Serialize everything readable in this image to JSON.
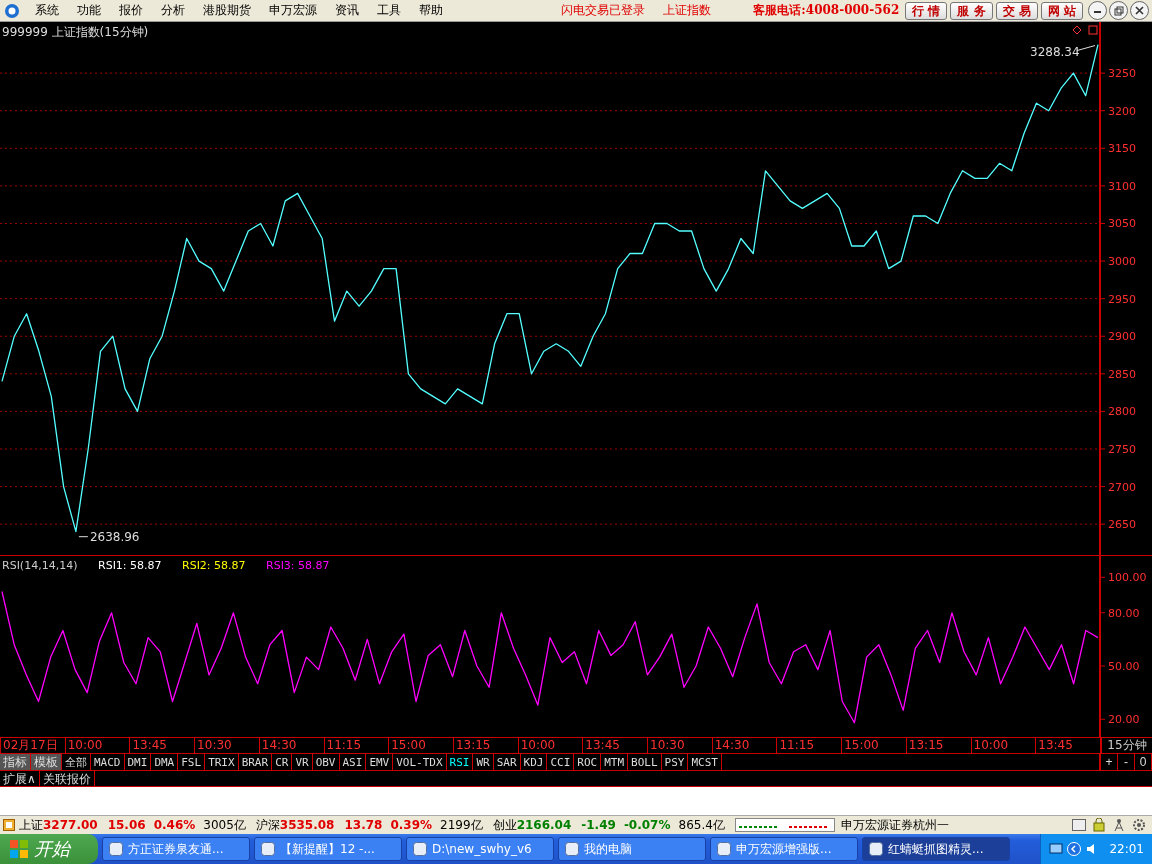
{
  "menu": {
    "items": [
      "系统",
      "功能",
      "报价",
      "分析",
      "港股期货",
      "申万宏源",
      "资讯",
      "工具",
      "帮助"
    ],
    "notices": [
      "闪电交易已登录",
      "上证指数"
    ],
    "hotline": "客服电话:4008-000-562",
    "buttons": [
      "行 情",
      "服 务",
      "交 易",
      "网 站"
    ]
  },
  "main_chart": {
    "title": "999999 上证指数(15分钟)",
    "chart_data": {
      "type": "line",
      "grid": true,
      "ylim": [
        2609,
        3318
      ],
      "yticks": [
        2650,
        2700,
        2750,
        2800,
        2850,
        2900,
        2950,
        3000,
        3050,
        3100,
        3150,
        3200,
        3250
      ],
      "series": [
        {
          "color": "#54ffff",
          "values": [
            2840,
            2900,
            2930,
            2880,
            2820,
            2700,
            2640,
            2750,
            2880,
            2900,
            2830,
            2800,
            2870,
            2900,
            2960,
            3030,
            3000,
            2990,
            2960,
            3000,
            3040,
            3050,
            3020,
            3080,
            3090,
            3060,
            3030,
            2920,
            2960,
            2940,
            2960,
            2990,
            2990,
            2850,
            2830,
            2820,
            2810,
            2830,
            2820,
            2810,
            2890,
            2930,
            2930,
            2850,
            2880,
            2890,
            2880,
            2860,
            2900,
            2930,
            2990,
            3010,
            3010,
            3050,
            3050,
            3040,
            3040,
            2990,
            2960,
            2990,
            3030,
            3010,
            3120,
            3100,
            3080,
            3070,
            3080,
            3090,
            3070,
            3020,
            3020,
            3040,
            2990,
            3000,
            3060,
            3060,
            3050,
            3090,
            3120,
            3110,
            3110,
            3130,
            3120,
            3170,
            3210,
            3200,
            3230,
            3250,
            3220,
            3288
          ]
        }
      ],
      "annotations": [
        {
          "text": "3288.34"
        },
        {
          "text": "2638.96"
        }
      ]
    }
  },
  "rsi_chart": {
    "name": "RSI(14,14,14)",
    "lines": [
      {
        "label": "RSI1: 58.87",
        "color": "#ffffff"
      },
      {
        "label": "RSI2: 58.87",
        "color": "#ffff00"
      },
      {
        "label": "RSI3: 58.87",
        "color": "#ff00ff"
      }
    ],
    "chart_data": {
      "type": "line",
      "ylim": [
        10,
        112
      ],
      "yticks": [
        {
          "value": 20,
          "label": "20.00"
        },
        {
          "value": 50,
          "label": "50.00"
        },
        {
          "value": 80,
          "label": "80.00"
        },
        {
          "value": 100,
          "label": "100.00"
        }
      ],
      "series": [
        {
          "color": "#ff00ff",
          "values": [
            92,
            62,
            45,
            30,
            55,
            70,
            48,
            35,
            64,
            80,
            52,
            40,
            66,
            58,
            30,
            52,
            74,
            45,
            60,
            80,
            55,
            40,
            62,
            70,
            35,
            55,
            48,
            72,
            60,
            42,
            65,
            40,
            58,
            68,
            30,
            56,
            62,
            44,
            70,
            50,
            38,
            80,
            60,
            45,
            28,
            66,
            52,
            58,
            40,
            70,
            56,
            62,
            75,
            45,
            55,
            68,
            38,
            50,
            72,
            60,
            44,
            66,
            85,
            52,
            40,
            58,
            62,
            48,
            70,
            30,
            18,
            55,
            62,
            45,
            25,
            60,
            70,
            52,
            80,
            58,
            45,
            66,
            40,
            55,
            72,
            60,
            48,
            62,
            40,
            70,
            66
          ]
        }
      ]
    }
  },
  "time_axis": {
    "labels": [
      "02月17日",
      "10:00",
      "13:45",
      "10:30",
      "14:30",
      "11:15",
      "15:00",
      "13:15",
      "10:00",
      "13:45",
      "10:30",
      "14:30",
      "11:15",
      "15:00",
      "13:15",
      "10:00",
      "13:45"
    ],
    "period": "15分钟"
  },
  "indicator_tabs": [
    {
      "label": "指标",
      "kind": "group",
      "selected": false
    },
    {
      "label": "模板",
      "kind": "group",
      "selected": false
    },
    {
      "label": "全部",
      "kind": "indicator",
      "selected": false
    },
    {
      "label": "MACD",
      "kind": "indicator",
      "selected": false
    },
    {
      "label": "DMI",
      "kind": "indicator",
      "selected": false
    },
    {
      "label": "DMA",
      "kind": "indicator",
      "selected": false
    },
    {
      "label": "FSL",
      "kind": "indicator",
      "selected": false
    },
    {
      "label": "TRIX",
      "kind": "indicator",
      "selected": false
    },
    {
      "label": "BRAR",
      "kind": "indicator",
      "selected": false
    },
    {
      "label": "CR",
      "kind": "indicator",
      "selected": false
    },
    {
      "label": "VR",
      "kind": "indicator",
      "selected": false
    },
    {
      "label": "OBV",
      "kind": "indicator",
      "selected": false
    },
    {
      "label": "ASI",
      "kind": "indicator",
      "selected": false
    },
    {
      "label": "EMV",
      "kind": "indicator",
      "selected": false
    },
    {
      "label": "VOL-TDX",
      "kind": "indicator",
      "selected": false
    },
    {
      "label": "RSI",
      "kind": "indicator",
      "selected": true
    },
    {
      "label": "WR",
      "kind": "indicator",
      "selected": false
    },
    {
      "label": "SAR",
      "kind": "indicator",
      "selected": false
    },
    {
      "label": "KDJ",
      "kind": "indicator",
      "selected": false
    },
    {
      "label": "CCI",
      "kind": "indicator",
      "selected": false
    },
    {
      "label": "ROC",
      "kind": "indicator",
      "selected": false
    },
    {
      "label": "MTM",
      "kind": "indicator",
      "selected": false
    },
    {
      "label": "BOLL",
      "kind": "indicator",
      "selected": false
    },
    {
      "label": "PSY",
      "kind": "indicator",
      "selected": false
    },
    {
      "label": "MCST",
      "kind": "indicator",
      "selected": false
    }
  ],
  "zoom_buttons": [
    "+",
    "-",
    "0"
  ],
  "bottom_tabs": [
    "扩展∧",
    "关联报价"
  ],
  "status_bar": {
    "indices": [
      {
        "name": "上证",
        "price": "3277.00",
        "change": "15.06",
        "percent": "0.46%",
        "amount": "3005亿",
        "color": "#e00000"
      },
      {
        "name": "沪深",
        "price": "3535.08",
        "change": "13.78",
        "percent": "0.39%",
        "amount": "2199亿",
        "color": "#e00000"
      },
      {
        "name": "创业",
        "price": "2166.04",
        "change": "-1.49",
        "percent": "-0.07%",
        "amount": "865.4亿",
        "color": "#008000"
      }
    ],
    "broker": "申万宏源证券杭州一"
  },
  "taskbar": {
    "start": "开始",
    "tasks": [
      {
        "label": "方正证券泉友通...",
        "selected": false
      },
      {
        "label": "【新提醒】12 -...",
        "selected": false
      },
      {
        "label": "D:\\new_swhy_v6",
        "selected": false
      },
      {
        "label": "我的电脑",
        "selected": false
      },
      {
        "label": "申万宏源增强版...",
        "selected": false
      },
      {
        "label": "红蜻蜓抓图精灵...",
        "selected": true
      }
    ],
    "clock": "22:01"
  }
}
